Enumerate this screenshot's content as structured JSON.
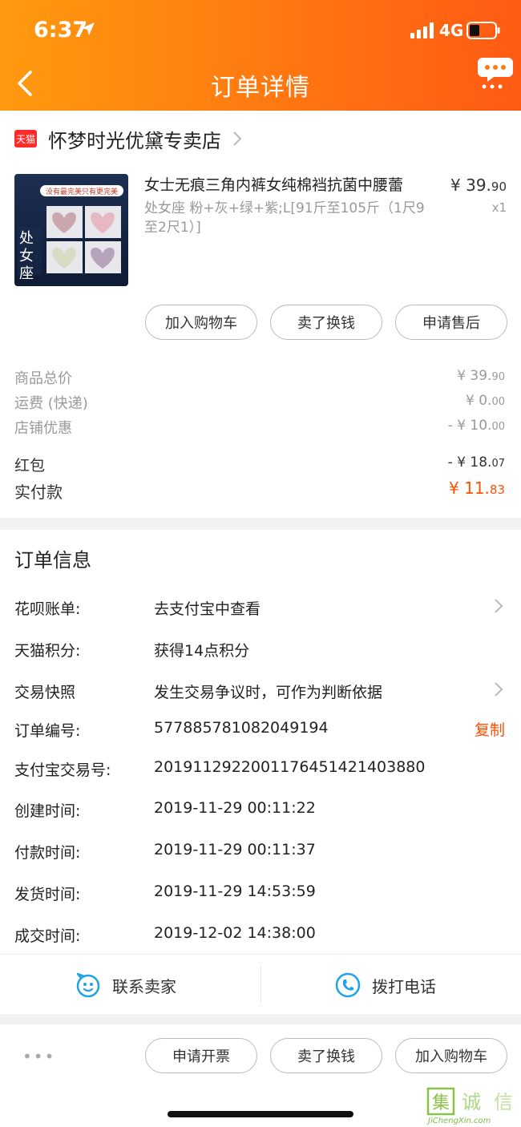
{
  "status_bar": {
    "time": "6:37",
    "network": "4G"
  },
  "nav": {
    "title": "订单详情"
  },
  "shop": {
    "badge": "天猫",
    "name": "怀梦时光优黛专卖店"
  },
  "product": {
    "image_caption_top": "没有最完美只有更完美",
    "image_caption_side": "处女座",
    "title": "女士无痕三角内裤女纯棉裆抗菌中腰蕾",
    "sku": "处女座  粉+灰+绿+紫;L[91斤至105斤（1尺9至2尺1）]",
    "price_int": "¥ 39.",
    "price_dec": "90",
    "qty": "x1"
  },
  "item_actions": [
    "加入购物车",
    "卖了换钱",
    "申请售后"
  ],
  "fees": [
    {
      "label": "商品总价",
      "int": "¥ 39.",
      "dec": "90"
    },
    {
      "label": "运费 (快递)",
      "int": "¥ 0.",
      "dec": "00"
    },
    {
      "label": "店铺优惠",
      "int": "- ¥ 10.",
      "dec": "00"
    },
    {
      "label": "红包",
      "int": "- ¥ 18.",
      "dec": "07"
    },
    {
      "label": "实付款",
      "int": "¥ 11.",
      "dec": "83"
    }
  ],
  "order_info": {
    "title": "订单信息",
    "rows": [
      {
        "label": "花呗账单:",
        "value": "去支付宝中查看"
      },
      {
        "label": "天猫积分:",
        "value": "获得14点积分"
      },
      {
        "label": "交易快照",
        "value": "发生交易争议时，可作为判断依据"
      },
      {
        "label": "订单编号:",
        "value": "577885781082049194"
      },
      {
        "label": "支付宝交易号:",
        "value": "2019112922001176451421403880"
      },
      {
        "label": "创建时间:",
        "value": "2019-11-29 00:11:22"
      },
      {
        "label": "付款时间:",
        "value": "2019-11-29 00:11:37"
      },
      {
        "label": "发货时间:",
        "value": "2019-11-29 14:53:59"
      },
      {
        "label": "成交时间:",
        "value": "2019-12-02 14:38:00"
      }
    ],
    "copy": "复制"
  },
  "contact": {
    "seller": "联系卖家",
    "phone": "拨打电话"
  },
  "bottom_actions": [
    "申请开票",
    "卖了换钱",
    "加入购物车"
  ],
  "bottom_more": "•••",
  "watermark": {
    "text": "JiChengXin.com"
  },
  "colors": {
    "accent": "#ff5000",
    "header_start": "#ff9a0f",
    "header_end": "#ff5a14",
    "contact_icon": "#1fa3e8"
  }
}
